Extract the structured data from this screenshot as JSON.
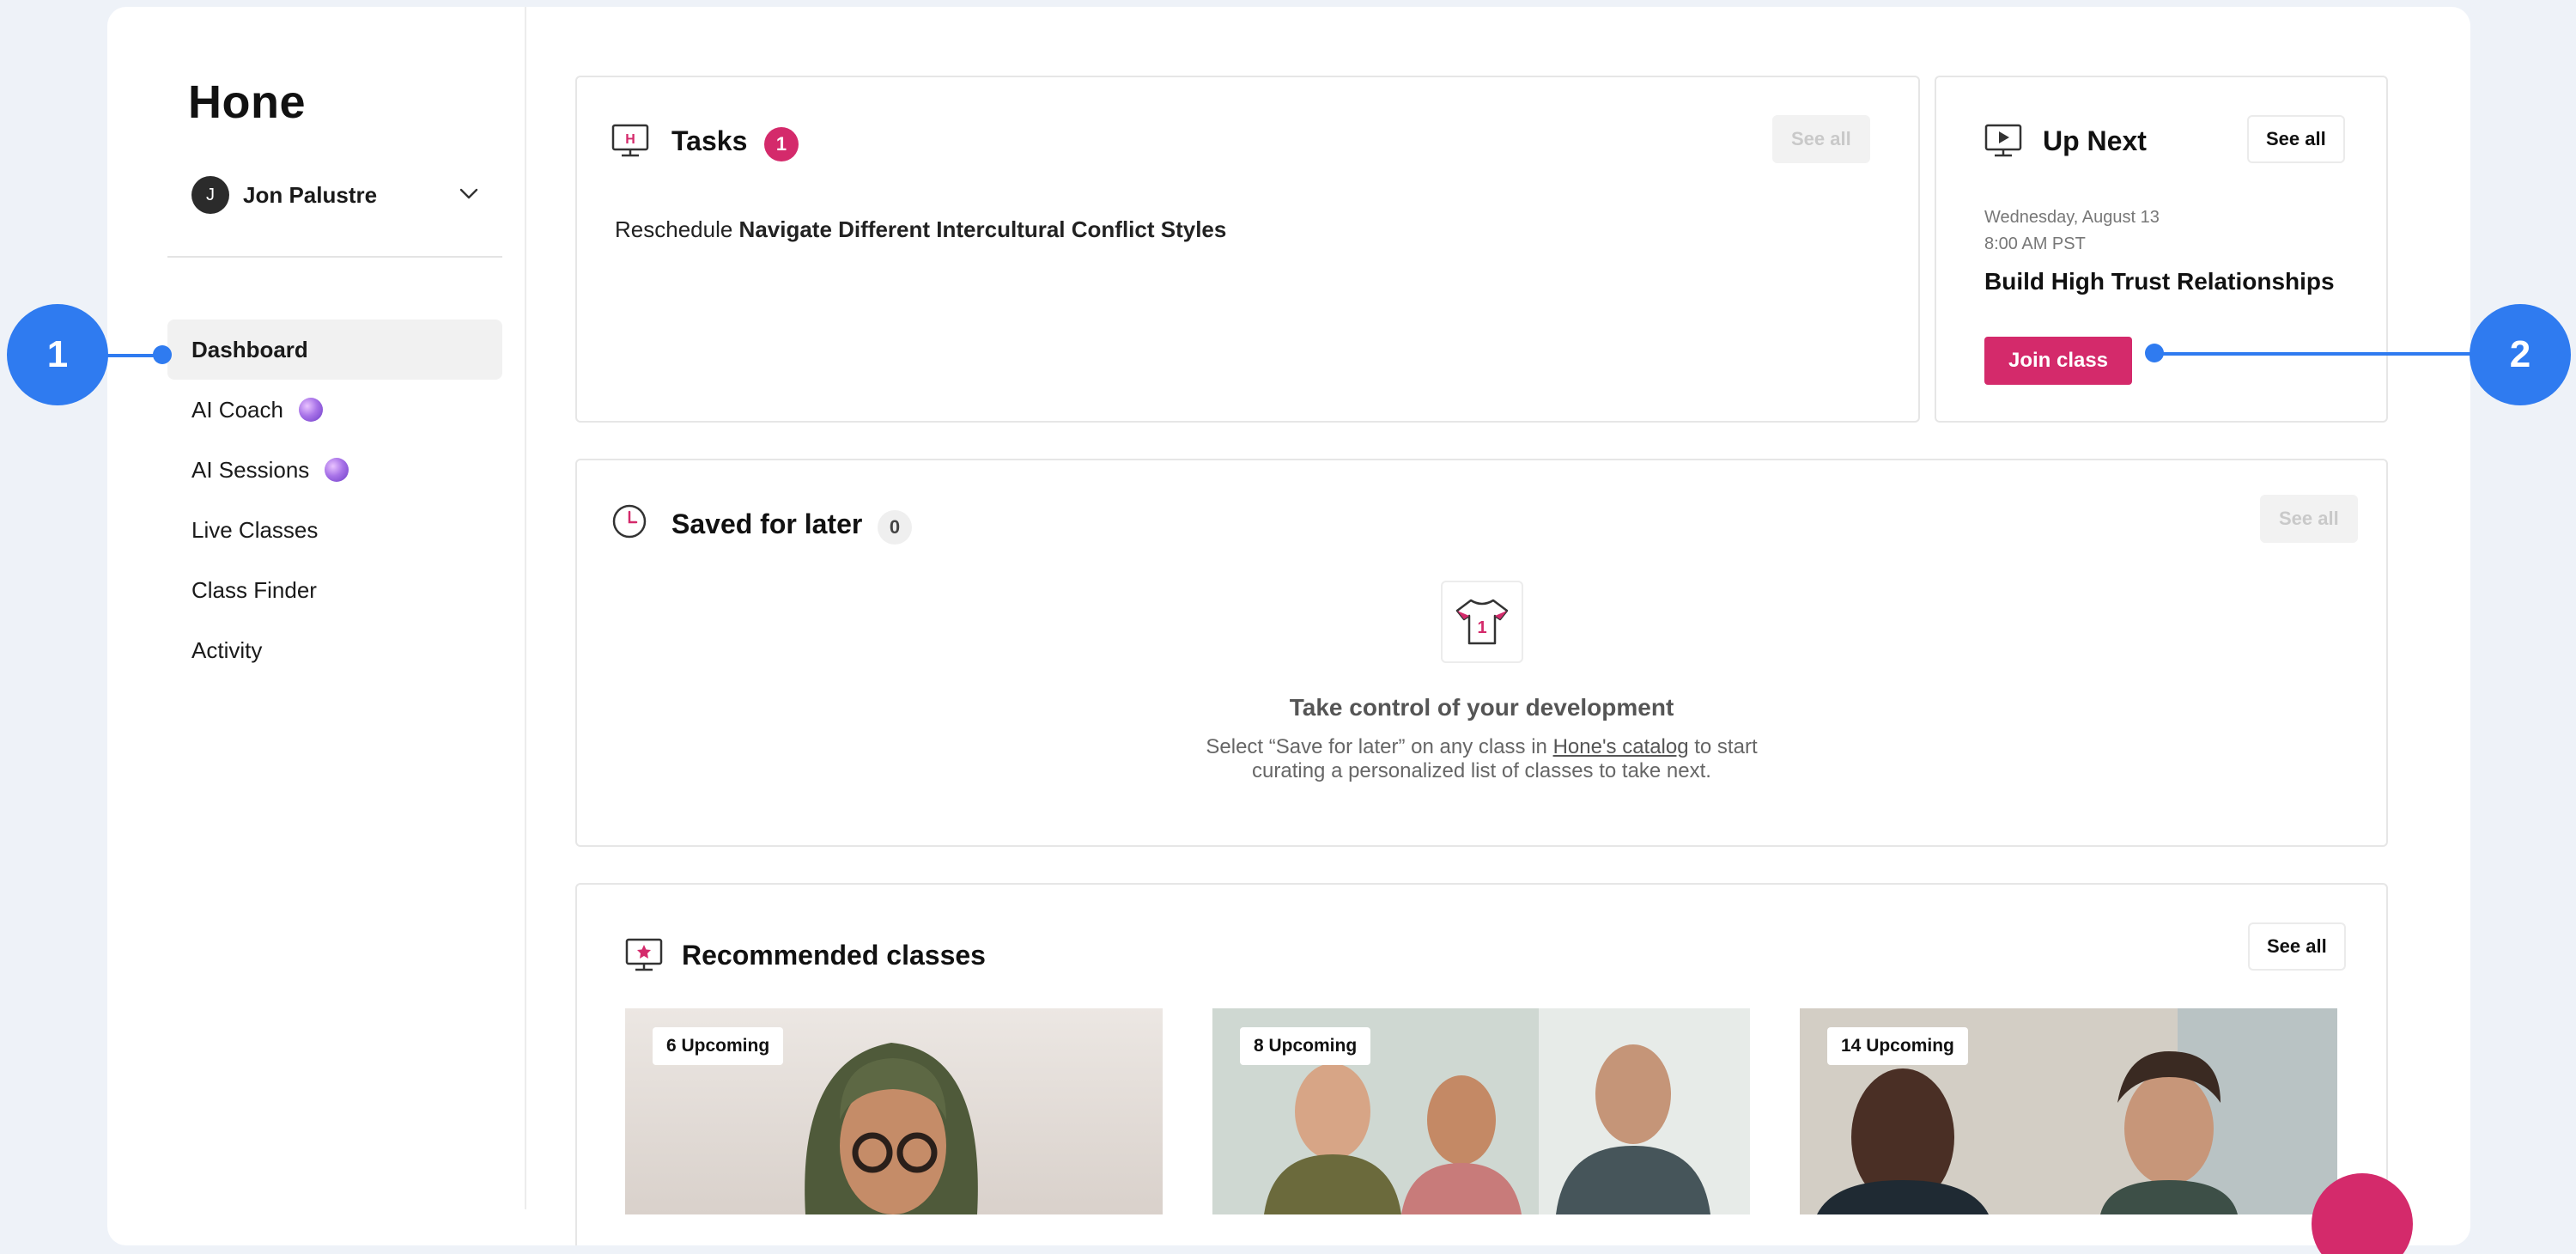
{
  "app": {
    "logo": "Hone"
  },
  "user": {
    "initial": "J",
    "name": "Jon Palustre"
  },
  "nav": {
    "items": [
      {
        "label": "Dashboard",
        "active": true
      },
      {
        "label": "AI Coach",
        "has_orb": true
      },
      {
        "label": "AI Sessions",
        "has_orb": true
      },
      {
        "label": "Live Classes"
      },
      {
        "label": "Class Finder"
      },
      {
        "label": "Activity"
      }
    ]
  },
  "tasks": {
    "title": "Tasks",
    "count": "1",
    "see_all": "See all",
    "item_prefix": "Reschedule",
    "item_title": "Navigate Different Intercultural Conflict Styles"
  },
  "up_next": {
    "title": "Up Next",
    "see_all": "See all",
    "date": "Wednesday, August 13",
    "time": "8:00 AM PST",
    "class_title": "Build High Trust Relationships",
    "join_label": "Join class"
  },
  "saved": {
    "title": "Saved for later",
    "count": "0",
    "see_all": "See all",
    "empty_title": "Take control of your development",
    "empty_desc_before": "Select “Save for later” on any class in ",
    "empty_desc_link": "Hone's catalog",
    "empty_desc_after": " to start",
    "empty_desc_line2": "curating a personalized list of classes to take next."
  },
  "recommended": {
    "title": "Recommended classes",
    "see_all": "See all",
    "tiles": [
      {
        "badge": "6 Upcoming"
      },
      {
        "badge": "8 Upcoming"
      },
      {
        "badge": "14 Upcoming"
      }
    ]
  },
  "callouts": {
    "one": "1",
    "two": "2"
  },
  "colors": {
    "accent": "#d42a6b",
    "callout": "#2f7bf0",
    "background": "#eef2f8"
  }
}
